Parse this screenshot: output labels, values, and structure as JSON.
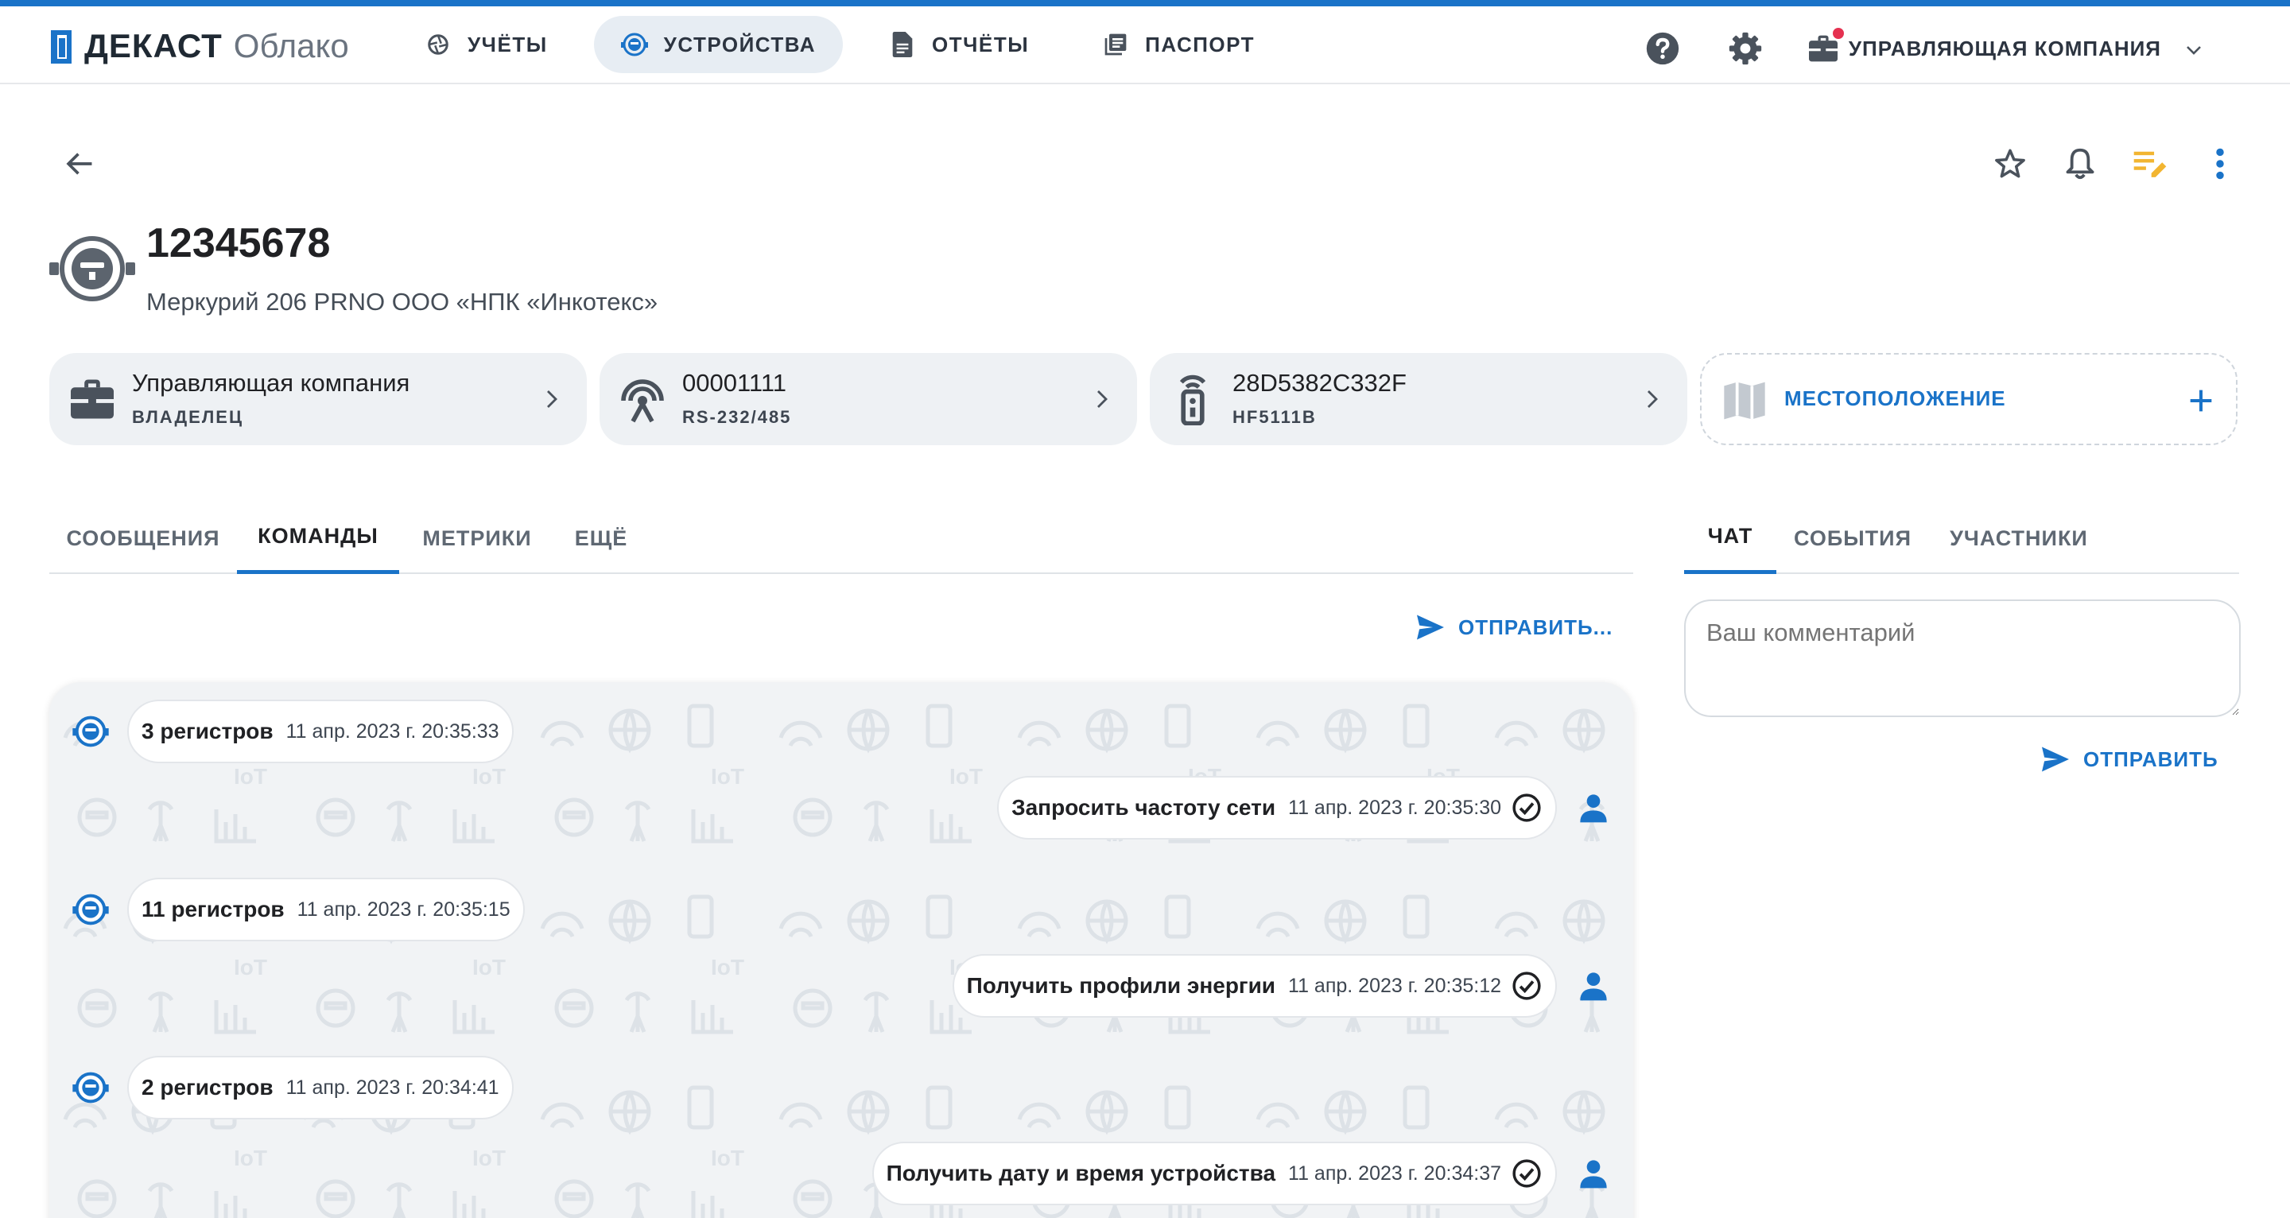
{
  "brand": {
    "name": "ДЕКАСТ",
    "product": "Облако"
  },
  "nav": [
    {
      "label": "УЧЁТЫ"
    },
    {
      "label": "УСТРОЙСТВА"
    },
    {
      "label": "ОТЧЁТЫ"
    },
    {
      "label": "ПАСПОРТ"
    }
  ],
  "header": {
    "company": "УПРАВЛЯЮЩАЯ КОМПАНИЯ"
  },
  "device": {
    "title": "12345678",
    "subtitle": "Меркурий 206 PRNO ООО «НПК «Инкотекс»"
  },
  "cards": [
    {
      "title": "Управляющая компания",
      "sub": "ВЛАДЕЛЕЦ"
    },
    {
      "title": "00001111",
      "sub": "RS-232/485"
    },
    {
      "title": "28D5382C332F",
      "sub": "HF5111B"
    },
    {
      "title": "МЕСТОПОЛОЖЕНИЕ"
    }
  ],
  "tabs": [
    "СООБЩЕНИЯ",
    "КОМАНДЫ",
    "МЕТРИКИ",
    "ЕЩЁ"
  ],
  "right_tabs": [
    "ЧАТ",
    "СОБЫТИЯ",
    "УЧАСТНИКИ"
  ],
  "send_label": "ОТПРАВИТЬ...",
  "comment": {
    "placeholder": "Ваш комментарий"
  },
  "send_chat_label": "ОТПРАВИТЬ",
  "messages": [
    {
      "text": "3 регистров",
      "date": "11 апр. 2023 г. 20:35:33"
    },
    {
      "text": "Запросить частоту сети",
      "date": "11 апр. 2023 г. 20:35:30"
    },
    {
      "text": "11 регистров",
      "date": "11 апр. 2023 г. 20:35:15"
    },
    {
      "text": "Получить профили энергии",
      "date": "11 апр. 2023 г. 20:35:12"
    },
    {
      "text": "2 регистров",
      "date": "11 апр. 2023 г. 20:34:41"
    },
    {
      "text": "Получить дату и время устройства",
      "date": "11 апр. 2023 г. 20:34:37"
    }
  ],
  "colors": {
    "accent": "#1a73c8",
    "surface": "#eef1f4",
    "alert": "#e53150",
    "edit": "#f2b531"
  }
}
